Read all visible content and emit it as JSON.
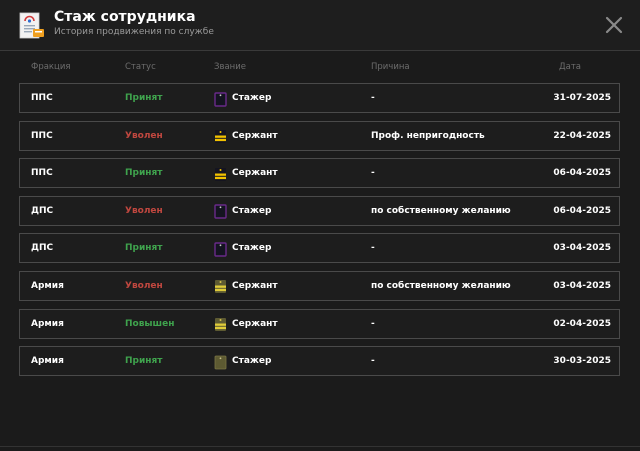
{
  "header": {
    "title": "Стаж сотрудника",
    "subtitle": "История продвижения по службе",
    "icon": "document-certificate-icon"
  },
  "columns": {
    "faction": "Фракция",
    "status": "Статус",
    "rank": "Звание",
    "reason": "Причина",
    "date": "Дата"
  },
  "colors": {
    "accepted": "#3fa34d",
    "fired": "#c0473f",
    "promoted": "#3fa34d"
  },
  "rows": [
    {
      "faction": "ППС",
      "status": "Принят",
      "status_kind": "accepted",
      "rank": "Стажер",
      "rank_icon": "police-trainee-shoulder-icon",
      "reason": "-",
      "date": "31-07-2025"
    },
    {
      "faction": "ППС",
      "status": "Уволен",
      "status_kind": "fired",
      "rank": "Сержант",
      "rank_icon": "police-sergeant-shoulder-icon",
      "reason": "Проф. непригодность",
      "date": "22-04-2025"
    },
    {
      "faction": "ППС",
      "status": "Принят",
      "status_kind": "accepted",
      "rank": "Сержант",
      "rank_icon": "police-sergeant-shoulder-icon",
      "reason": "-",
      "date": "06-04-2025"
    },
    {
      "faction": "ДПС",
      "status": "Уволен",
      "status_kind": "fired",
      "rank": "Стажер",
      "rank_icon": "police-trainee-shoulder-icon",
      "reason": "по собственному желанию",
      "date": "06-04-2025"
    },
    {
      "faction": "ДПС",
      "status": "Принят",
      "status_kind": "accepted",
      "rank": "Стажер",
      "rank_icon": "police-trainee-shoulder-icon",
      "reason": "-",
      "date": "03-04-2025"
    },
    {
      "faction": "Армия",
      "status": "Уволен",
      "status_kind": "fired",
      "rank": "Сержант",
      "rank_icon": "army-sergeant-shoulder-icon",
      "reason": "по собственному желанию",
      "date": "03-04-2025"
    },
    {
      "faction": "Армия",
      "status": "Повышен",
      "status_kind": "promoted",
      "rank": "Сержант",
      "rank_icon": "army-sergeant-shoulder-icon",
      "reason": "-",
      "date": "02-04-2025"
    },
    {
      "faction": "Армия",
      "status": "Принят",
      "status_kind": "accepted",
      "rank": "Стажер",
      "rank_icon": "army-trainee-shoulder-icon",
      "reason": "-",
      "date": "30-03-2025"
    }
  ]
}
